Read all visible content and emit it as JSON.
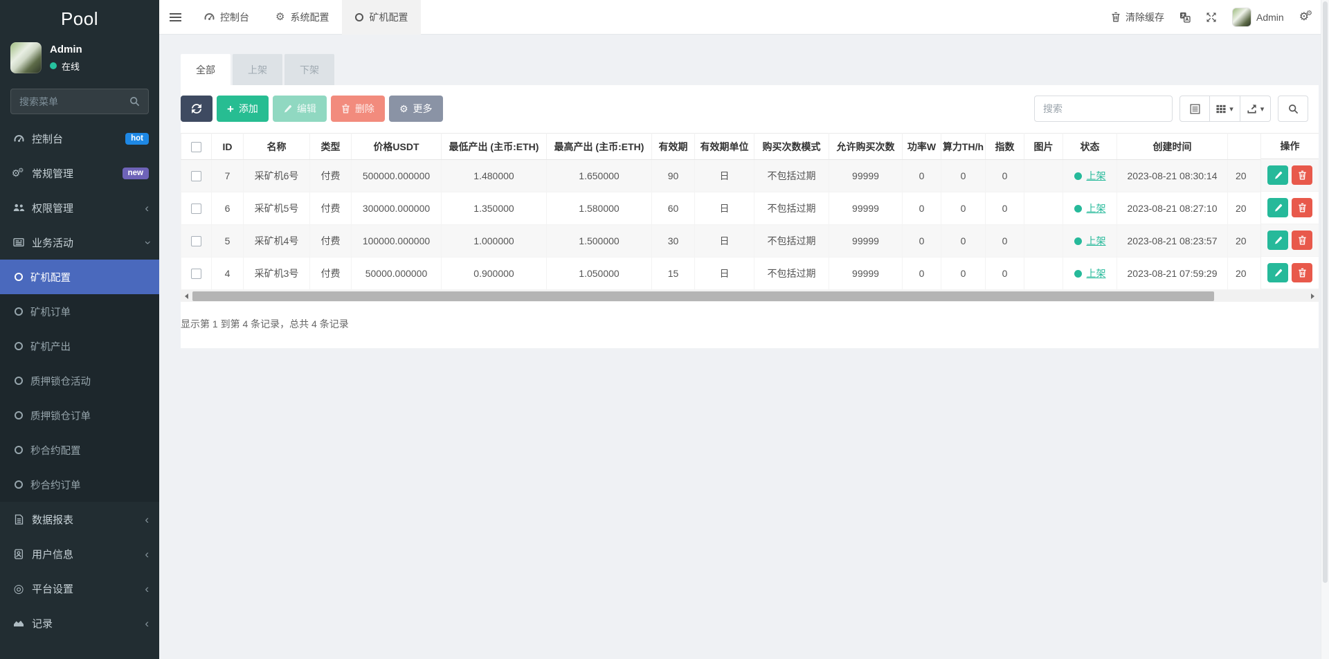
{
  "brand": "Pool",
  "sidebar": {
    "user": {
      "name": "Admin",
      "status": "在线"
    },
    "search_placeholder": "搜索菜单",
    "menu_top": [
      {
        "label": "控制台",
        "icon": "tachometer",
        "badge": "hot"
      },
      {
        "label": "常规管理",
        "icon": "gears",
        "badge": "new"
      },
      {
        "label": "权限管理",
        "icon": "users",
        "chevron": "left"
      },
      {
        "label": "业务活动",
        "icon": "newspaper",
        "chevron": "down"
      }
    ],
    "submenu": [
      {
        "label": "矿机配置",
        "active": true
      },
      {
        "label": "矿机订单"
      },
      {
        "label": "矿机产出"
      },
      {
        "label": "质押锁仓活动"
      },
      {
        "label": "质押锁仓订单"
      },
      {
        "label": "秒合约配置"
      },
      {
        "label": "秒合约订单"
      }
    ],
    "menu_bottom": [
      {
        "label": "数据报表",
        "icon": "file",
        "chevron": "left"
      },
      {
        "label": "用户信息",
        "icon": "address-book",
        "chevron": "left"
      },
      {
        "label": "平台设置",
        "icon": "bullseye",
        "chevron": "left"
      },
      {
        "label": "记录",
        "icon": "chart-area",
        "chevron": "left"
      }
    ]
  },
  "navbar": {
    "tabs": [
      {
        "label": "控制台",
        "icon": "tachometer"
      },
      {
        "label": "系统配置",
        "icon": "gear"
      },
      {
        "label": "矿机配置",
        "icon": "circle",
        "active": true
      }
    ],
    "clear_cache": "清除缓存",
    "username": "Admin"
  },
  "filter_tabs": [
    {
      "label": "全部",
      "active": true
    },
    {
      "label": "上架"
    },
    {
      "label": "下架"
    }
  ],
  "toolbar": {
    "add": "添加",
    "edit": "编辑",
    "del": "删除",
    "more": "更多",
    "search_placeholder": "搜索"
  },
  "table": {
    "columns": [
      "ID",
      "名称",
      "类型",
      "价格USDT",
      "最低产出 (主币:ETH)",
      "最高产出 (主币:ETH)",
      "有效期",
      "有效期单位",
      "购买次数模式",
      "允许购买次数",
      "功率W",
      "算力TH/h",
      "指数",
      "图片",
      "状态",
      "创建时间",
      ""
    ],
    "ops_label": "操作",
    "rows": [
      {
        "id": "7",
        "name": "采矿机6号",
        "type": "付费",
        "price": "500000.000000",
        "min_output": "1.480000",
        "max_output": "1.650000",
        "period": "90",
        "period_unit": "日",
        "buy_mode": "不包括过期",
        "buy_limit": "99999",
        "power": "0",
        "hashrate": "0",
        "index": "0",
        "image": "",
        "status": "上架",
        "created_at": "2023-08-21 08:30:14",
        "clipped": "20"
      },
      {
        "id": "6",
        "name": "采矿机5号",
        "type": "付费",
        "price": "300000.000000",
        "min_output": "1.350000",
        "max_output": "1.580000",
        "period": "60",
        "period_unit": "日",
        "buy_mode": "不包括过期",
        "buy_limit": "99999",
        "power": "0",
        "hashrate": "0",
        "index": "0",
        "image": "",
        "status": "上架",
        "created_at": "2023-08-21 08:27:10",
        "clipped": "20"
      },
      {
        "id": "5",
        "name": "采矿机4号",
        "type": "付费",
        "price": "100000.000000",
        "min_output": "1.000000",
        "max_output": "1.500000",
        "period": "30",
        "period_unit": "日",
        "buy_mode": "不包括过期",
        "buy_limit": "99999",
        "power": "0",
        "hashrate": "0",
        "index": "0",
        "image": "",
        "status": "上架",
        "created_at": "2023-08-21 08:23:57",
        "clipped": "20"
      },
      {
        "id": "4",
        "name": "采矿机3号",
        "type": "付费",
        "price": "50000.000000",
        "min_output": "0.900000",
        "max_output": "1.050000",
        "period": "15",
        "period_unit": "日",
        "buy_mode": "不包括过期",
        "buy_limit": "99999",
        "power": "0",
        "hashrate": "0",
        "index": "0",
        "image": "",
        "status": "上架",
        "created_at": "2023-08-21 07:59:29",
        "clipped": "20"
      }
    ],
    "summary": "显示第 1 到第 4 条记录，总共 4 条记录"
  },
  "colors": {
    "sidebar_bg": "#222d32",
    "active_blue": "#4a69bd",
    "accent_green": "#26b99a",
    "danger_red": "#e8594b",
    "badge_hot": "#1e88e5",
    "badge_new": "#6e63b8"
  }
}
